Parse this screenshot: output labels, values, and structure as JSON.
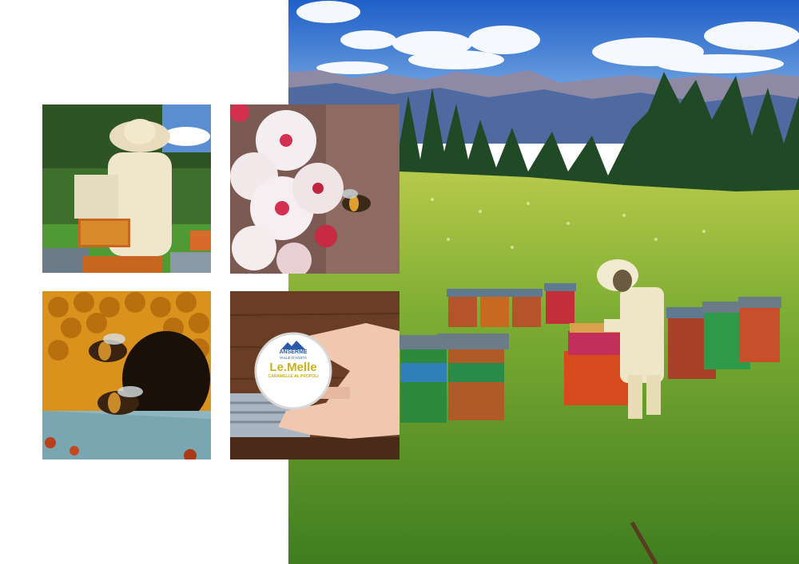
{
  "collage": {
    "product_tin": {
      "brand_top": "ANSERME",
      "brand_sub": "VALLE D'AOSTA",
      "name": "Le.Melle",
      "tagline": "CARAMELLE AL PROPOLI"
    }
  },
  "icons": [
    "mountain-logo-icon"
  ],
  "colors": {
    "sky": "#2f6fd6",
    "meadow": "#5e9a2b",
    "forest": "#1f4a25",
    "honey": "#d98a1a",
    "tin_text": "#c9b21a",
    "tin_blue": "#2a5aa8"
  }
}
